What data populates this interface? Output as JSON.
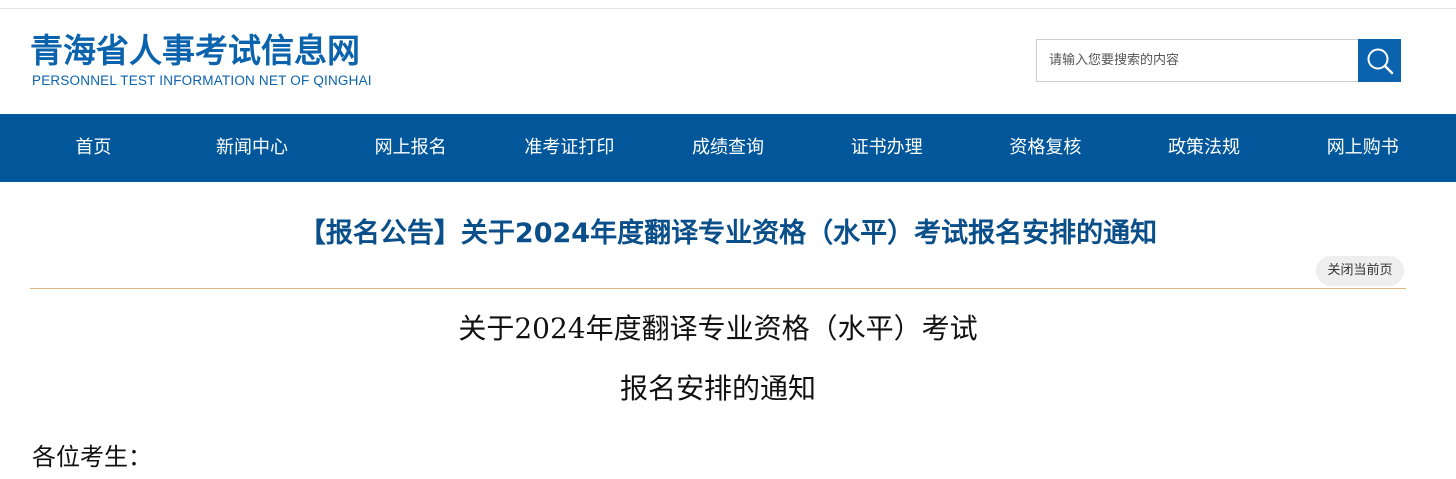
{
  "header": {
    "logo_cn": "青海省人事考试信息网",
    "logo_en": "PERSONNEL TEST INFORMATION NET OF QINGHAI",
    "search": {
      "placeholder": "请输入您要搜索的内容",
      "button_icon": "search-icon"
    }
  },
  "nav": {
    "items": [
      {
        "label": "首页"
      },
      {
        "label": "新闻中心"
      },
      {
        "label": "网上报名"
      },
      {
        "label": "准考证打印"
      },
      {
        "label": "成绩查询"
      },
      {
        "label": "证书办理"
      },
      {
        "label": "资格复核"
      },
      {
        "label": "政策法规"
      },
      {
        "label": "网上购书"
      }
    ]
  },
  "article": {
    "title": "【报名公告】关于2024年度翻译专业资格（水平）考试报名安排的通知",
    "close_label": "关闭当前页",
    "doc_title_line1": "关于2024年度翻译专业资格（水平）考试",
    "doc_title_line2": "报名安排的通知",
    "salutation": "各位考生："
  },
  "colors": {
    "brand_blue": "#0b63ae",
    "nav_blue": "#02579a",
    "divider_gold": "#d9b779"
  }
}
